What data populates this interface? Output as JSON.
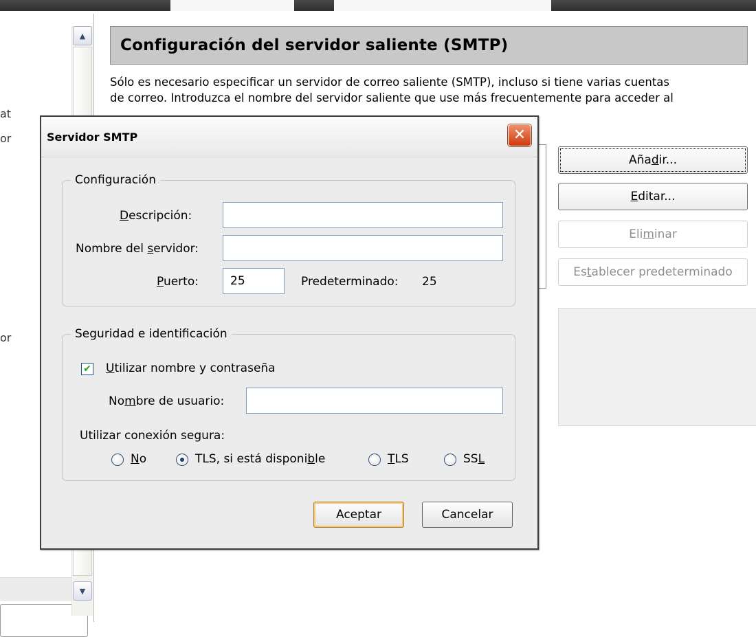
{
  "left_fragments": [
    "at",
    "or",
    "or"
  ],
  "panel": {
    "title": "Configuración del servidor saliente (SMTP)",
    "desc_line1": "Sólo es necesario especificar un servidor de correo saliente (SMTP), incluso si tiene varias cuentas",
    "desc_line2": "de correo. Introduzca el nombre del servidor saliente que use más frecuentemente para acceder al"
  },
  "buttons": {
    "add": {
      "pre": "Aña",
      "acc": "d",
      "post": "ir..."
    },
    "edit": {
      "pre": "",
      "acc": "E",
      "post": "ditar..."
    },
    "delete": {
      "pre": "Eli",
      "acc": "m",
      "post": "inar"
    },
    "set_default": {
      "pre": "Es",
      "acc": "t",
      "post": "ablecer predeterminado"
    }
  },
  "dialog": {
    "title": "Servidor SMTP",
    "config_legend": "Configuración",
    "description_label": {
      "pre": "",
      "acc": "D",
      "post": "escripción:"
    },
    "description_value": "",
    "server_label": {
      "pre": "Nombre del ",
      "acc": "s",
      "post": "ervidor:"
    },
    "server_value": "",
    "port_label": {
      "pre": "",
      "acc": "P",
      "post": "uerto:"
    },
    "port_value": "25",
    "default_label": "Predeterminado:",
    "default_value": "25",
    "security_legend": "Seguridad e identificación",
    "use_auth_label": {
      "pre": "",
      "acc": "U",
      "post": "tilizar nombre y contraseña"
    },
    "use_auth_checked": true,
    "username_label": {
      "pre": "No",
      "acc": "m",
      "post": "bre de usuario:"
    },
    "username_value": "",
    "secure_label": "Utilizar conexión segura:",
    "options": [
      {
        "pre": "",
        "acc": "N",
        "post": "o",
        "selected": false
      },
      {
        "pre": "TLS, si está disponi",
        "acc": "b",
        "post": "le",
        "selected": true
      },
      {
        "pre": "",
        "acc": "T",
        "post": "LS",
        "selected": false
      },
      {
        "pre": "SS",
        "acc": "L",
        "post": "",
        "selected": false
      }
    ],
    "ok_label": "Aceptar",
    "cancel_label": "Cancelar"
  }
}
